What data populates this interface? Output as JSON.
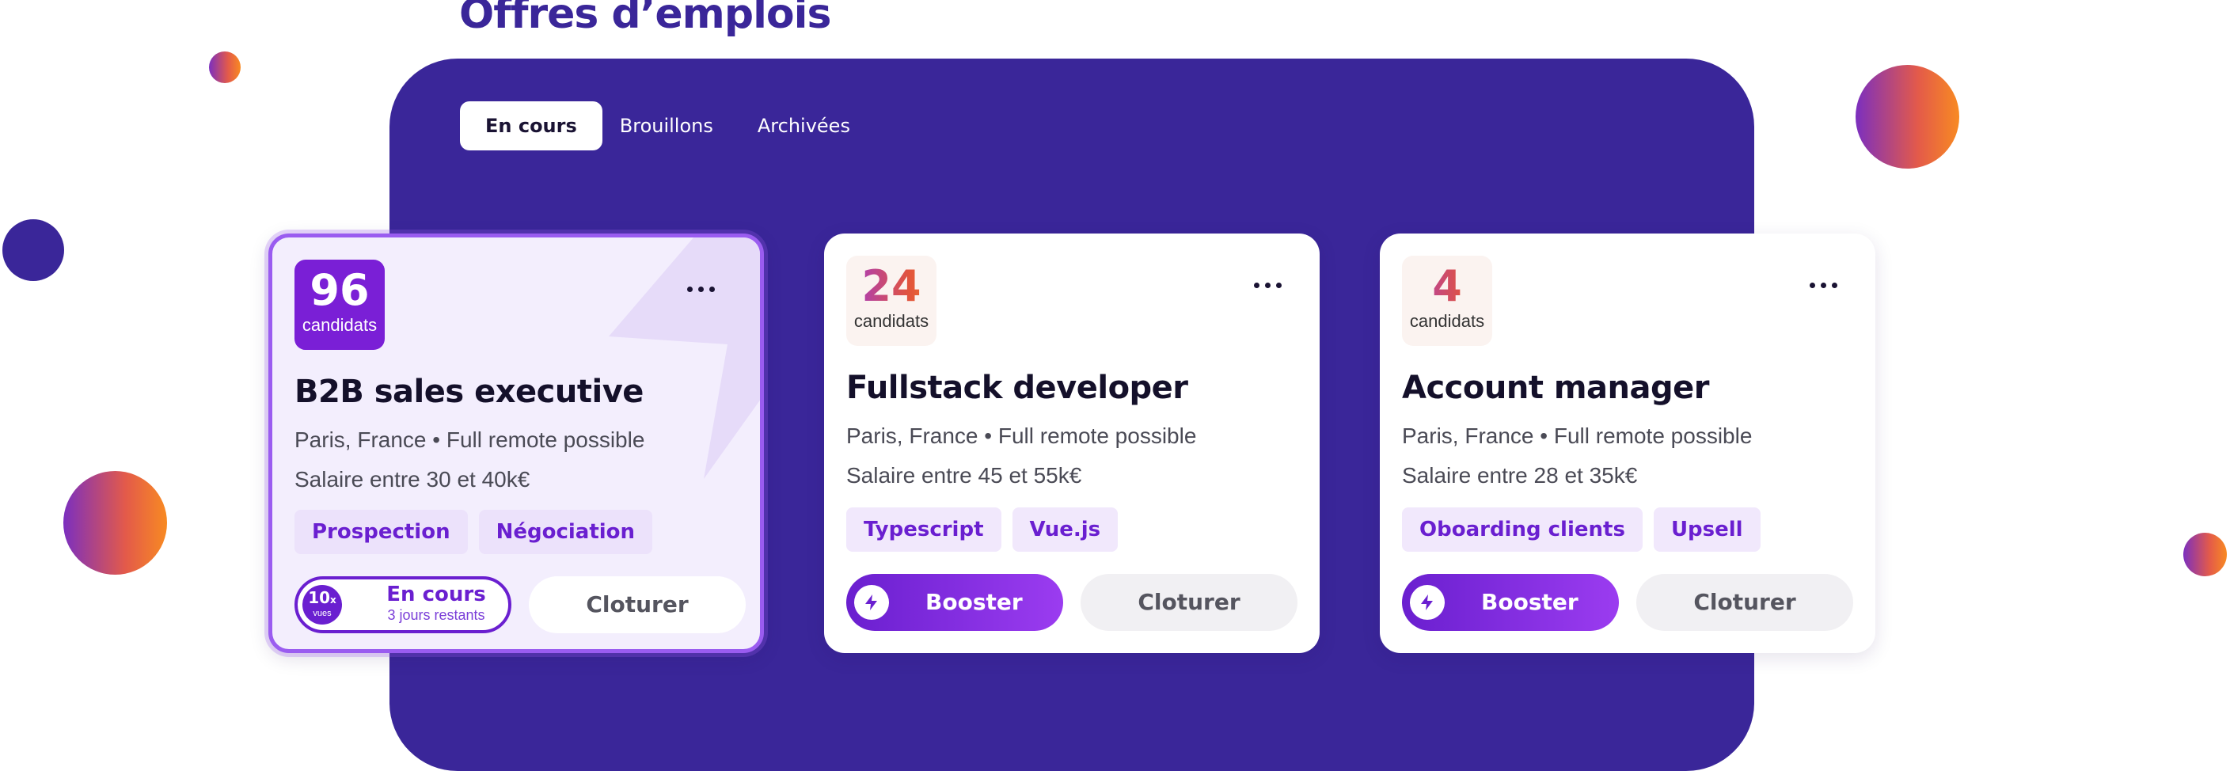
{
  "page": {
    "title": "Offres d’emplois"
  },
  "tabs": [
    {
      "label": "En cours",
      "active": true
    },
    {
      "label": "Brouillons",
      "active": false
    },
    {
      "label": "Archivées",
      "active": false
    }
  ],
  "jobs": [
    {
      "count": "96",
      "count_label": "candidats",
      "title": "B2B sales executive",
      "location": "Paris, France • Full remote possible",
      "salary": "Salaire entre 30 et 40k€",
      "tags": [
        "Prospection",
        "Négociation"
      ],
      "status": {
        "views": "10",
        "views_suffix": "x",
        "views_label": "vues",
        "label": "En cours",
        "remaining": "3 jours restants"
      },
      "close_label": "Cloturer"
    },
    {
      "count": "24",
      "count_label": "candidats",
      "title": "Fullstack developer",
      "location": "Paris, France • Full remote possible",
      "salary": "Salaire entre 45 et 55k€",
      "tags": [
        "Typescript",
        "Vue.js"
      ],
      "boost_label": "Booster",
      "close_label": "Cloturer"
    },
    {
      "count": "4",
      "count_label": "candidats",
      "title": "Account manager",
      "location": "Paris, France • Full remote possible",
      "salary": "Salaire entre 28 et 35k€",
      "tags": [
        "Oboarding clients",
        "Upsell"
      ],
      "boost_label": "Booster",
      "close_label": "Cloturer"
    }
  ],
  "colors": {
    "brand": "#3a2699",
    "accent": "#6a1fd0",
    "gradient_start": "#7b2fbf",
    "gradient_end": "#f88a22"
  },
  "icons": {
    "more": "more-horizontal-icon",
    "boost": "lightning-bolt-icon"
  }
}
